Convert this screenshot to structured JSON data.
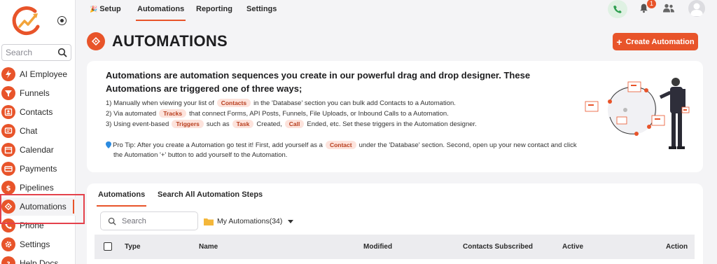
{
  "sidebar": {
    "search_placeholder": "Search",
    "items": [
      {
        "label": "AI Employee",
        "icon": "lightning-icon"
      },
      {
        "label": "Funnels",
        "icon": "funnel-icon"
      },
      {
        "label": "Contacts",
        "icon": "contacts-icon"
      },
      {
        "label": "Chat",
        "icon": "chat-icon"
      },
      {
        "label": "Calendar",
        "icon": "calendar-icon"
      },
      {
        "label": "Payments",
        "icon": "payments-icon"
      },
      {
        "label": "Pipelines",
        "icon": "dollar-icon"
      },
      {
        "label": "Automations",
        "icon": "automation-icon"
      },
      {
        "label": "Phone",
        "icon": "phone-icon"
      },
      {
        "label": "Settings",
        "icon": "gear-icon"
      },
      {
        "label": "Help Docs",
        "icon": "help-icon"
      }
    ]
  },
  "topnav": {
    "tabs": [
      "Setup",
      "Automations",
      "Reporting",
      "Settings"
    ],
    "setup_emoji": "🎉",
    "notification_count": "1"
  },
  "header": {
    "title": "AUTOMATIONS",
    "create_button": "Create Automation"
  },
  "info": {
    "heading": "Automations are automation sequences you create in our powerful drag and drop designer. These Automations are triggered one of three ways;",
    "line1": {
      "a": "1) Manually when viewing your list of",
      "chip": "Contacts",
      "b": "in the 'Database' section you can bulk add Contacts to a Automation."
    },
    "line2": {
      "a": "2) Via automated",
      "chip": "Tracks",
      "b": "that connect Forms, API Posts, Funnels, File Uploads, or Inbound Calls to a Automation."
    },
    "line3": {
      "a": "3) Using event-based",
      "chip1": "Triggers",
      "b": "such as",
      "chip2": "Task",
      "c": "Created,",
      "chip3": "Call",
      "d": "Ended, etc. Set these triggers in the Automation designer."
    },
    "tip": {
      "a": "Pro Tip: After you create a Automation go test it! First, add yourself as a",
      "chip": "Contact",
      "b": "under the 'Database' section. Second, open up your new contact and click",
      "c": "the Automation '+' button to add yourself to the Automation."
    }
  },
  "table": {
    "tabs": [
      "Automations",
      "Search All Automation Steps"
    ],
    "search_placeholder": "Search",
    "folder_label": "My Automations(34)",
    "columns": [
      "Type",
      "Name",
      "Modified",
      "Contacts Subscribed",
      "Active",
      "Action"
    ]
  },
  "colors": {
    "accent": "#e8542a",
    "highlight": "#e4414b"
  }
}
